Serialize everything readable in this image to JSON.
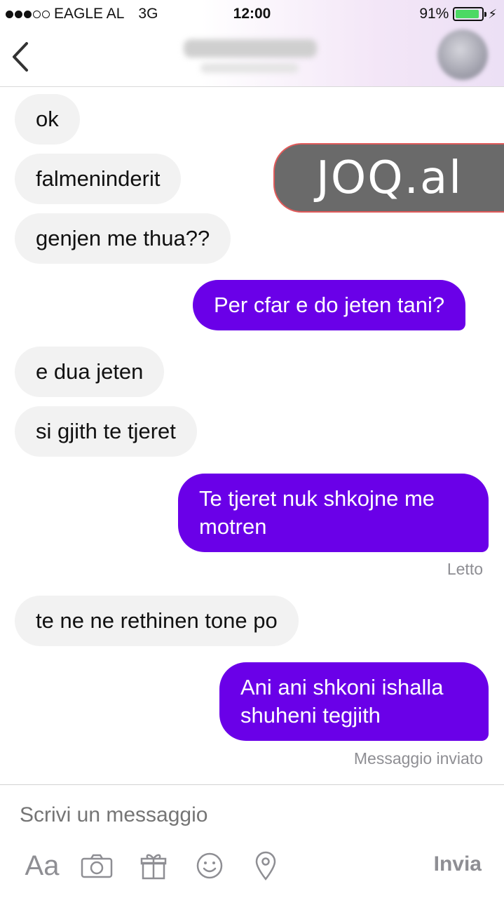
{
  "status_bar": {
    "carrier": "EAGLE AL",
    "network": "3G",
    "time": "12:00",
    "battery": "91%"
  },
  "header": {
    "back_icon": "chevron-left-icon",
    "contact_name": "",
    "contact_status": ""
  },
  "watermark": {
    "text": "JOQ.al"
  },
  "messages": [
    {
      "direction": "in",
      "text": "ok"
    },
    {
      "direction": "in",
      "text": "falmeninderit"
    },
    {
      "direction": "in",
      "text": "genjen me thua??"
    },
    {
      "direction": "out",
      "text": "Per cfar e do jeten tani?"
    },
    {
      "direction": "in",
      "text": "e dua jeten"
    },
    {
      "direction": "in",
      "text": "si gjith te tjeret"
    },
    {
      "direction": "out",
      "text": "Te tjeret nuk shkojne me motren",
      "status": "Letto"
    },
    {
      "direction": "in",
      "text": "te ne ne rethinen tone po"
    },
    {
      "direction": "out",
      "text": "Ani ani shkoni ishalla shuheni tegjith",
      "status": "Messaggio inviato"
    }
  ],
  "composer": {
    "placeholder": "Scrivi un messaggio",
    "text_format_label": "Aa",
    "send_label": "Invia",
    "icons": [
      "camera-icon",
      "gift-icon",
      "smiley-icon",
      "location-pin-icon"
    ]
  },
  "colors": {
    "outgoing_bubble": "#6a00e8",
    "incoming_bubble": "#f2f2f2",
    "muted_text": "#8e8e93"
  }
}
